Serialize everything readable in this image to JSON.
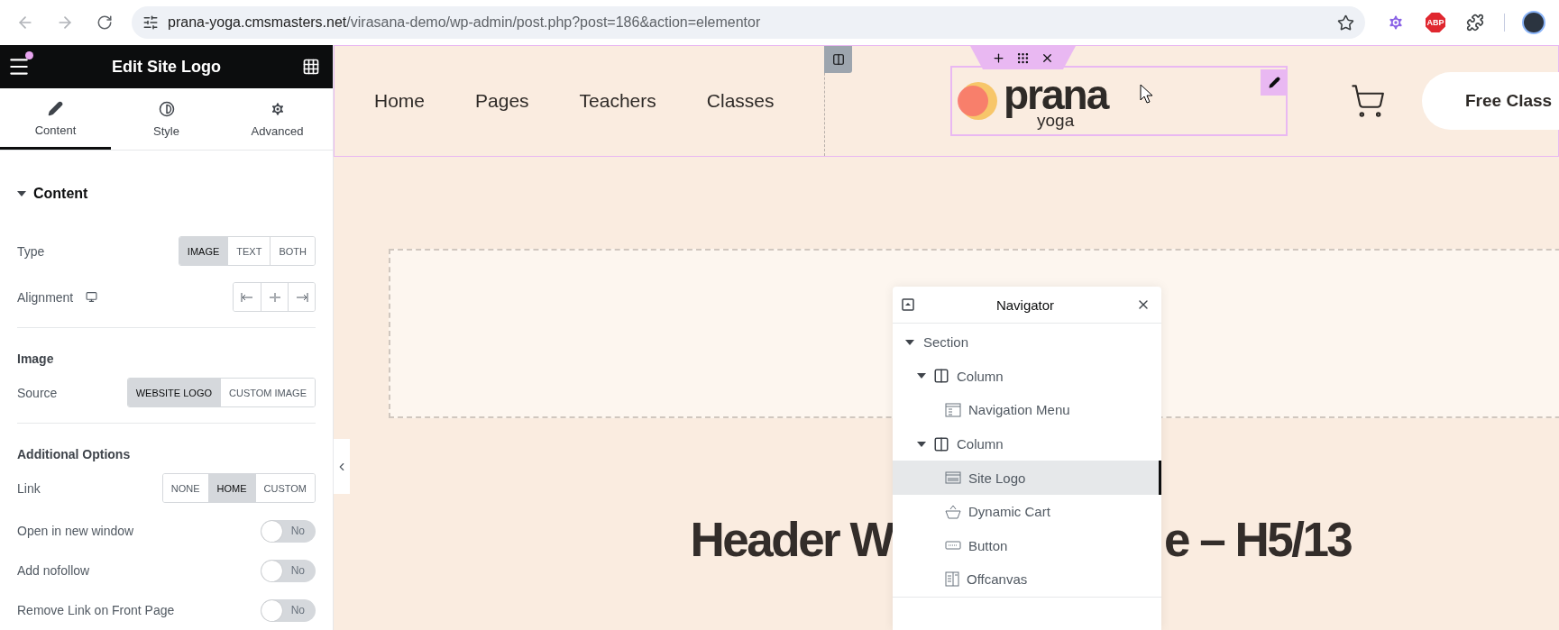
{
  "browser": {
    "url_host": "prana-yoga.cmsmasters.net",
    "url_path": "/virasana-demo/wp-admin/post.php?post=186&action=elementor",
    "adblock_badge": "ABP"
  },
  "editor_panel": {
    "title": "Edit Site Logo",
    "has_notification": true,
    "tabs": [
      {
        "label": "Content",
        "kind": "pencil",
        "selected": true
      },
      {
        "label": "Style",
        "kind": "contrast",
        "selected": false
      },
      {
        "label": "Advanced",
        "kind": "gear",
        "selected": false
      }
    ],
    "section": {
      "title": "Content",
      "expanded": true
    },
    "controls": [
      {
        "kind": "choice",
        "label": "Type",
        "options": [
          {
            "label": "IMAGE",
            "selected": true
          },
          {
            "label": "TEXT",
            "selected": false
          },
          {
            "label": "BOTH",
            "selected": false
          }
        ]
      },
      {
        "kind": "alignment",
        "label": "Alignment"
      },
      {
        "kind": "divider"
      },
      {
        "kind": "heading",
        "label": "Image"
      },
      {
        "kind": "choice",
        "label": "Source",
        "options": [
          {
            "label": "WEBSITE LOGO",
            "selected": true
          },
          {
            "label": "CUSTOM IMAGE",
            "selected": false
          }
        ]
      },
      {
        "kind": "divider"
      },
      {
        "kind": "heading",
        "label": "Additional Options"
      },
      {
        "kind": "choice",
        "label": "Link",
        "options": [
          {
            "label": "NONE",
            "selected": false
          },
          {
            "label": "HOME",
            "selected": true
          },
          {
            "label": "CUSTOM",
            "selected": false
          }
        ]
      },
      {
        "kind": "switch",
        "label": "Open in new window",
        "value": "No",
        "on": false
      },
      {
        "kind": "switch",
        "label": "Add nofollow",
        "value": "No",
        "on": false
      },
      {
        "kind": "switch",
        "label": "Remove Link on Front Page",
        "value": "No",
        "on": false
      }
    ]
  },
  "canvas": {
    "menu": [
      "Home",
      "Pages",
      "Teachers",
      "Classes"
    ],
    "logo": {
      "name": "prana",
      "tagline": "yoga"
    },
    "cta_button": "Free Class",
    "heading_parts": [
      "Header W",
      "e – H5/13"
    ]
  },
  "navigator": {
    "title": "Navigator",
    "tree": [
      {
        "label": "Section",
        "expanded": true,
        "selected": false,
        "children": [
          {
            "label": "Column",
            "kind": "column",
            "expanded": true,
            "selected": false,
            "children": [
              {
                "label": "Navigation Menu",
                "kind": "menu",
                "selected": false
              }
            ]
          },
          {
            "label": "Column",
            "kind": "column",
            "expanded": true,
            "selected": false,
            "children": [
              {
                "label": "Site Logo",
                "kind": "logo",
                "selected": true
              },
              {
                "label": "Dynamic Cart",
                "kind": "cart",
                "selected": false
              },
              {
                "label": "Button",
                "kind": "button",
                "selected": false
              },
              {
                "label": "Offcanvas",
                "kind": "offcanvas",
                "selected": false
              }
            ]
          }
        ]
      }
    ]
  }
}
